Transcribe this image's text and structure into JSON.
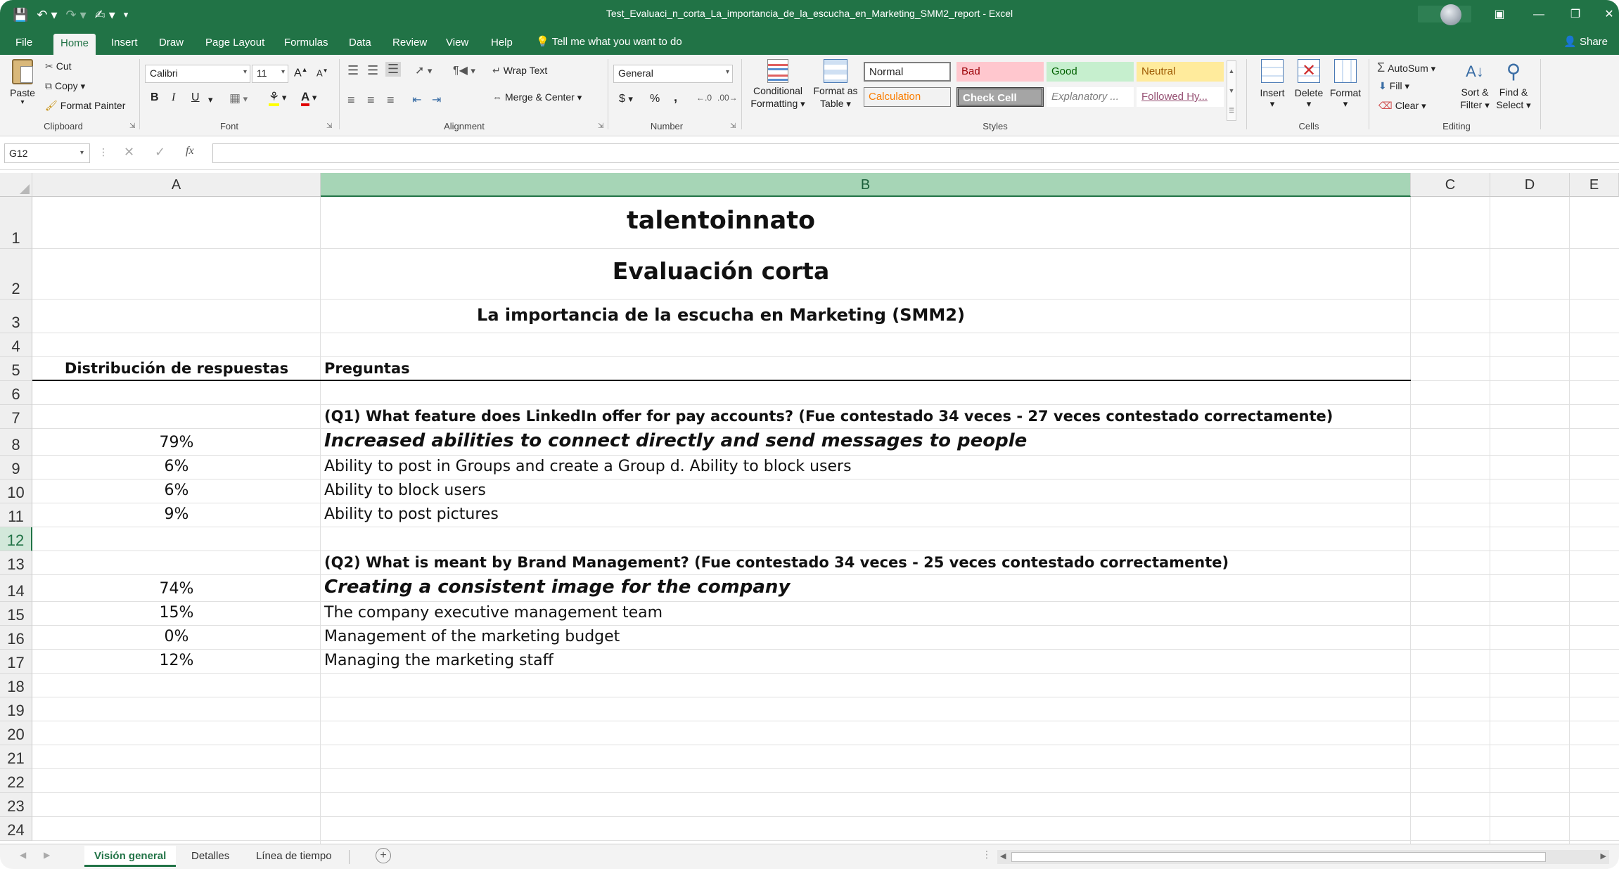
{
  "window": {
    "title": "Test_Evaluaci_n_corta_La_importancia_de_la_escucha_en_Marketing_SMM2_report  -  Excel"
  },
  "ribbon_tabs": [
    "File",
    "Home",
    "Insert",
    "Draw",
    "Page Layout",
    "Formulas",
    "Data",
    "Review",
    "View",
    "Help"
  ],
  "active_tab": "Home",
  "tell_me": "Tell me what you want to do",
  "share": "Share",
  "clipboard": {
    "paste": "Paste",
    "cut": "Cut",
    "copy": "Copy",
    "format_painter": "Format Painter",
    "label": "Clipboard"
  },
  "font": {
    "name": "Calibri",
    "size": "11",
    "label": "Font",
    "bold": "B",
    "italic": "I",
    "underline": "U"
  },
  "alignment": {
    "wrap_text": "Wrap Text",
    "merge_center": "Merge & Center",
    "label": "Alignment"
  },
  "number": {
    "format": "General",
    "label": "Number",
    "currency": "$",
    "percent": "%",
    "comma": ","
  },
  "styles": {
    "conditional_formatting": "Conditional Formatting",
    "format_as_table": "Format as Table",
    "cells": [
      {
        "name": "Normal",
        "color": "#222222",
        "bg": "#ffffff",
        "border": "#7f7f7f"
      },
      {
        "name": "Bad",
        "color": "#9c0006",
        "bg": "#ffc7ce",
        "border": "#ffc7ce"
      },
      {
        "name": "Good",
        "color": "#006100",
        "bg": "#c6efce",
        "border": "#c6efce"
      },
      {
        "name": "Neutral",
        "color": "#9c5700",
        "bg": "#ffeb9c",
        "border": "#ffeb9c"
      },
      {
        "name": "Calculation",
        "color": "#fa7d00",
        "bg": "#f2f2f2",
        "border": "#7f7f7f"
      },
      {
        "name": "Check Cell",
        "color": "#ffffff",
        "bg": "#a5a5a5",
        "border": "#3f3f3f"
      },
      {
        "name": "Explanatory ...",
        "color": "#7f7f7f",
        "bg": "#ffffff",
        "border": "#ffffff"
      },
      {
        "name": "Followed Hy...",
        "color": "#954f72",
        "bg": "#ffffff",
        "border": "#ffffff"
      }
    ],
    "label": "Styles"
  },
  "cells_group": {
    "insert": "Insert",
    "delete": "Delete",
    "format": "Format",
    "label": "Cells"
  },
  "editing": {
    "autosum": "AutoSum",
    "fill": "Fill",
    "clear": "Clear",
    "sort_filter": "Sort & Filter",
    "find_select": "Find & Select",
    "label": "Editing"
  },
  "formula_bar": {
    "name_box": "G12",
    "fx": "fx",
    "value": ""
  },
  "columns": [
    "A",
    "B",
    "C",
    "D",
    "E"
  ],
  "selected_column": "B",
  "selected_row": 12,
  "rows": [
    "1",
    "2",
    "3",
    "4",
    "5",
    "6",
    "7",
    "8",
    "9",
    "10",
    "11",
    "12",
    "13",
    "14",
    "15",
    "16",
    "17",
    "18",
    "19",
    "20",
    "21",
    "22",
    "23",
    "24"
  ],
  "sheet": {
    "r1": "talentoinnato",
    "r2": "Evaluación corta",
    "r3": "La importancia de la escucha en Marketing (SMM2)",
    "r5_a": "Distribución de respuestas",
    "r5_b": "Preguntas",
    "q1": "(Q1) What feature does LinkedIn offer for pay accounts? (Fue contestado 34 veces - 27 veces contestado correctamente)",
    "q1_answers": [
      {
        "pct": "79%",
        "text": "Increased abilities to connect directly and send messages to people",
        "correct": true
      },
      {
        "pct": "6%",
        "text": "Ability to post in Groups and create a Group d. Ability to block users",
        "correct": false
      },
      {
        "pct": "6%",
        "text": "Ability to block users",
        "correct": false
      },
      {
        "pct": "9%",
        "text": "Ability to post pictures",
        "correct": false
      }
    ],
    "q2": "(Q2) What is meant by Brand Management? (Fue contestado 34 veces - 25 veces contestado correctamente)",
    "q2_answers": [
      {
        "pct": "74%",
        "text": "Creating a consistent image for the company",
        "correct": true
      },
      {
        "pct": "15%",
        "text": "The company executive management team",
        "correct": false
      },
      {
        "pct": "0%",
        "text": "Management of the marketing budget",
        "correct": false
      },
      {
        "pct": "12%",
        "text": "Managing the marketing staff",
        "correct": false
      }
    ]
  },
  "sheet_tabs": [
    "Visión general",
    "Detalles",
    "Línea de tiempo"
  ],
  "active_sheet": "Visión general",
  "accent": "#217346"
}
